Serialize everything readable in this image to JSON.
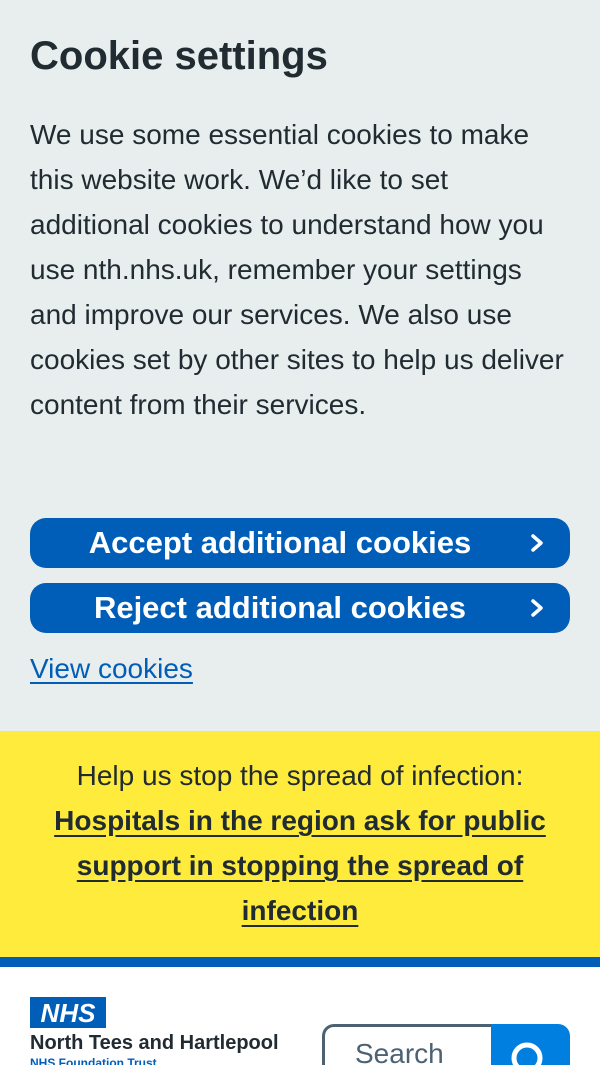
{
  "cookie_banner": {
    "title": "Cookie settings",
    "body": "We use some essential cookies to make this website work. We’d like to set additional cookies to understand how you use nth.nhs.uk, remember your settings and improve our services. We also use cookies set by other sites to help us deliver content from their services.",
    "accept_label": "Accept additional cookies",
    "reject_label": "Reject additional cookies",
    "view_cookies_label": "View cookies"
  },
  "alert": {
    "intro": "Help us stop the spread of infection:",
    "link_text": "Hospitals in the region ask for public support in stopping the spread of infection"
  },
  "header": {
    "logo_text": "NHS",
    "org_name": "North Tees and Hartlepool",
    "org_subtitle": "NHS Foundation Trust",
    "search_placeholder": "Search",
    "search_icon": "search-icon"
  },
  "colors": {
    "nhs_blue": "#005eb8",
    "banner_grey": "#e8edee",
    "alert_yellow": "#ffeb3b",
    "text_dark": "#212b32",
    "search_button_blue": "#007fe0"
  }
}
